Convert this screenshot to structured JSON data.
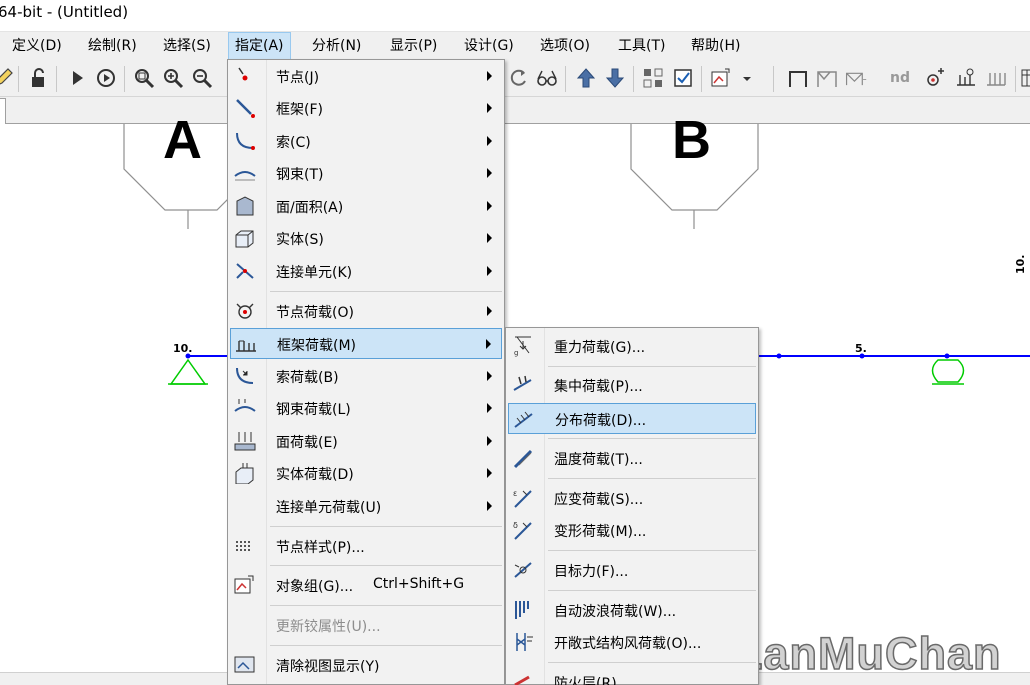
{
  "window": {
    "title": "64-bit - (Untitled)"
  },
  "menubar": {
    "items": [
      {
        "label": "定义(D)"
      },
      {
        "label": "绘制(R)"
      },
      {
        "label": "选择(S)"
      },
      {
        "label": "指定(A)",
        "active": true
      },
      {
        "label": "分析(N)"
      },
      {
        "label": "显示(P)"
      },
      {
        "label": "设计(G)"
      },
      {
        "label": "选项(O)"
      },
      {
        "label": "工具(T)"
      },
      {
        "label": "帮助(H)"
      }
    ]
  },
  "toolbar": {
    "nd_label": "nd"
  },
  "canvas": {
    "grid_labels": [
      "A",
      "B"
    ],
    "node_labels": [
      "10.",
      "5.",
      "10."
    ],
    "colors": {
      "frame_line": "#0000ff",
      "support": "#00cc00"
    }
  },
  "assign_menu": {
    "items": [
      {
        "label": "节点(J)",
        "icon": "joint-icon",
        "submenu": true
      },
      {
        "label": "框架(F)",
        "icon": "frame-icon",
        "submenu": true
      },
      {
        "label": "索(C)",
        "icon": "cable-icon",
        "submenu": true
      },
      {
        "label": "钢束(T)",
        "icon": "tendon-icon",
        "submenu": true
      },
      {
        "label": "面/面积(A)",
        "icon": "area-icon",
        "submenu": true
      },
      {
        "label": "实体(S)",
        "icon": "solid-icon",
        "submenu": true
      },
      {
        "label": "连接单元(K)",
        "icon": "link-icon",
        "submenu": true
      },
      {
        "label": "节点荷载(O)",
        "icon": "joint-load-icon",
        "submenu": true
      },
      {
        "label": "框架荷载(M)",
        "icon": "frame-load-icon",
        "submenu": true,
        "highlighted": true
      },
      {
        "label": "索荷载(B)",
        "icon": "cable-load-icon",
        "submenu": true
      },
      {
        "label": "钢束荷载(L)",
        "icon": "tendon-load-icon",
        "submenu": true
      },
      {
        "label": "面荷载(E)",
        "icon": "area-load-icon",
        "submenu": true
      },
      {
        "label": "实体荷载(D)",
        "icon": "solid-load-icon",
        "submenu": true
      },
      {
        "label": "连接单元荷载(U)",
        "icon": "link-load-icon",
        "submenu": true
      },
      {
        "label": "节点样式(P)...",
        "icon": "joint-pattern-icon"
      },
      {
        "label": "对象组(G)...",
        "shortcut": "Ctrl+Shift+G",
        "icon": "group-icon"
      },
      {
        "label": "更新铰属性(U)...",
        "disabled": true
      },
      {
        "label": "清除视图显示(Y)",
        "icon": "clear-display-icon"
      }
    ]
  },
  "frame_load_submenu": {
    "items": [
      {
        "label": "重力荷载(G)...",
        "icon": "gravity-load-icon"
      },
      {
        "label": "集中荷载(P)...",
        "icon": "point-load-icon"
      },
      {
        "label": "分布荷载(D)...",
        "icon": "distributed-load-icon",
        "highlighted": true
      },
      {
        "label": "温度荷载(T)...",
        "icon": "temperature-load-icon"
      },
      {
        "label": "应变荷载(S)...",
        "icon": "strain-load-icon"
      },
      {
        "label": "变形荷载(M)...",
        "icon": "deformation-load-icon"
      },
      {
        "label": "目标力(F)...",
        "icon": "target-force-icon"
      },
      {
        "label": "自动波浪荷载(W)...",
        "icon": "wave-load-icon"
      },
      {
        "label": "开敞式结构风荷载(O)...",
        "icon": "wind-load-icon"
      },
      {
        "label": "防火层(R)...",
        "icon": "fireproofing-icon"
      }
    ]
  },
  "watermark": {
    "text": "LanMuChan"
  }
}
